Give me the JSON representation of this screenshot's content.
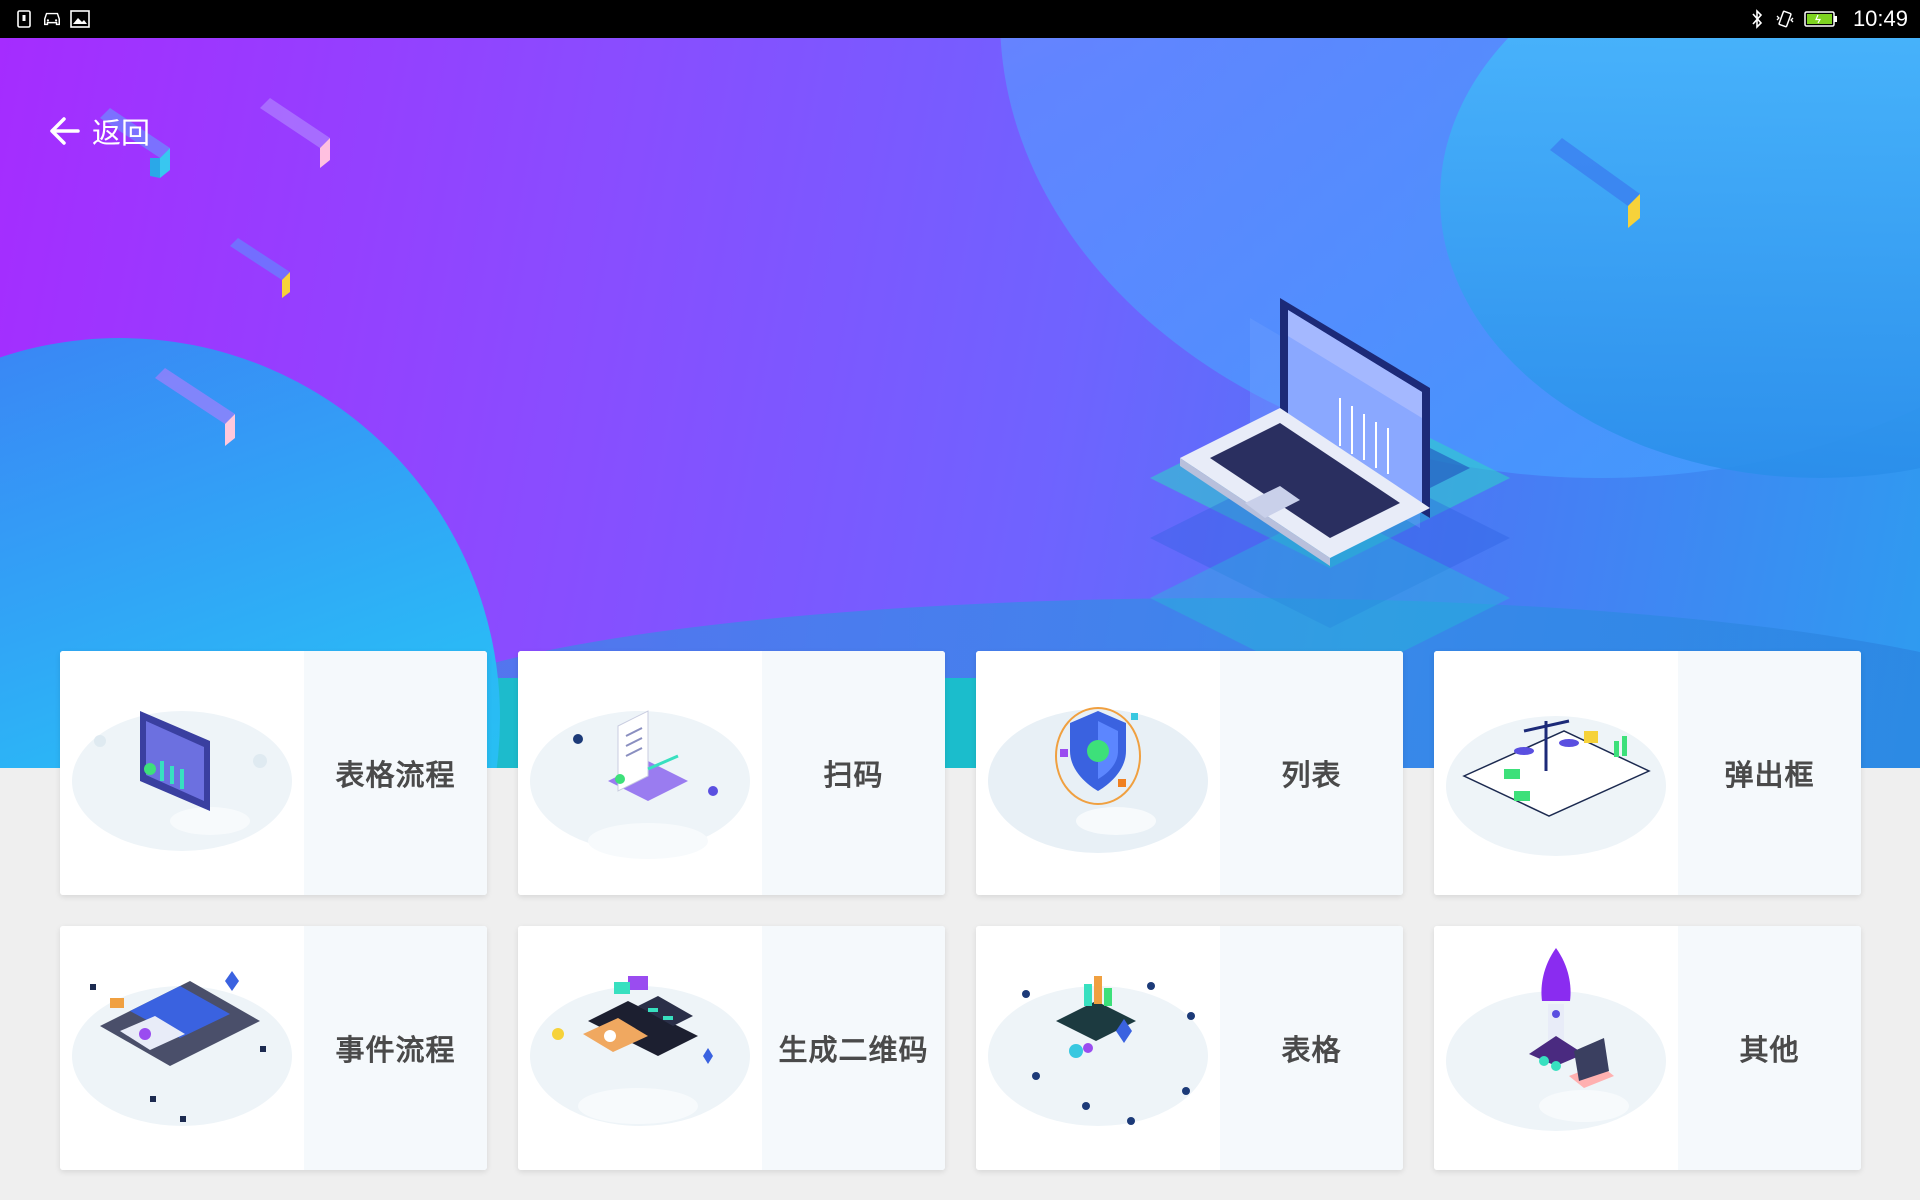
{
  "status_bar": {
    "left_icons": [
      "sim-card-icon",
      "car-icon",
      "image-icon"
    ],
    "right_icons": [
      "bluetooth-icon",
      "vibrate-icon",
      "battery-icon"
    ],
    "time": "10:49"
  },
  "header": {
    "back_icon": "arrow-left-icon",
    "back_label": "返回"
  },
  "colors": {
    "hero_start": "#a52cff",
    "hero_end": "#2e9cf0",
    "card_bg": "#ffffff",
    "card_text_bg": "#f5f9fc",
    "label_color": "#4a4a4a",
    "page_bg": "#efefef"
  },
  "menu": {
    "items": [
      {
        "label": "表格流程",
        "icon": "dashboard-screen-icon"
      },
      {
        "label": "扫码",
        "icon": "phone-scan-icon"
      },
      {
        "label": "列表",
        "icon": "shield-check-icon"
      },
      {
        "label": "弹出框",
        "icon": "balance-scale-icon"
      },
      {
        "label": "事件流程",
        "icon": "document-flow-icon"
      },
      {
        "label": "生成二维码",
        "icon": "phone-qrcode-icon"
      },
      {
        "label": "表格",
        "icon": "chart-blocks-icon"
      },
      {
        "label": "其他",
        "icon": "rocket-icon"
      }
    ]
  }
}
